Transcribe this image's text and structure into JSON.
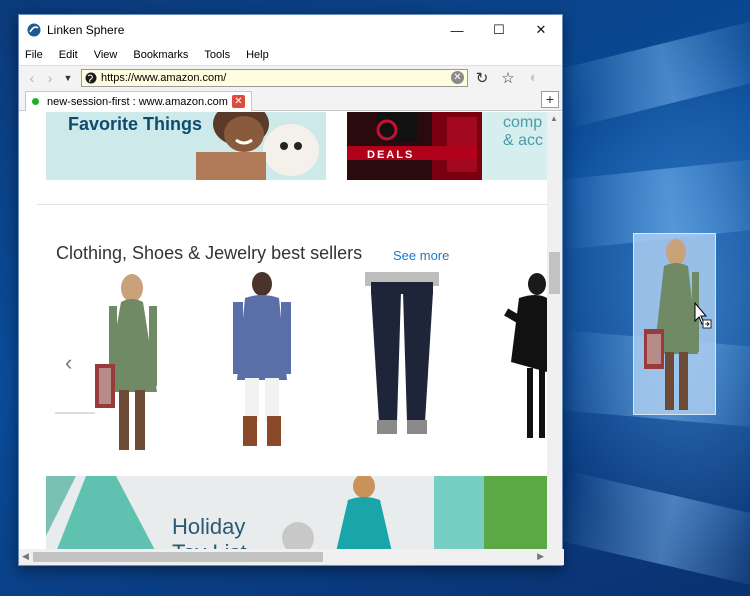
{
  "window": {
    "title": "Linken Sphere",
    "controls": {
      "minimize": "—",
      "maximize": "☐",
      "close": "✕"
    }
  },
  "menu": [
    "File",
    "Edit",
    "View",
    "Bookmarks",
    "Tools",
    "Help"
  ],
  "navbar": {
    "url": "https://www.amazon.com/",
    "back_icon": "back-arrow-icon",
    "forward_icon": "forward-arrow-icon",
    "history_icon": "chevron-down-icon"
  },
  "tab": {
    "label": "new-session-first : www.amazon.com",
    "status_color": "#1fae2c",
    "new_tab_label": "+"
  },
  "page": {
    "banner_left_text": "Favorite Things",
    "banner_right_deals": "DEALS",
    "banner_right_text_1": "comp",
    "banner_right_text_2": "& acc",
    "section_title": "Clothing, Shoes & Jewelry best sellers",
    "see_more": "See more",
    "holiday_line1": "Holiday",
    "holiday_line2": "Toy List"
  },
  "colors": {
    "accent_link": "#1f78c1",
    "url_bg": "#fffce0",
    "tab_close": "#e04a3a"
  }
}
